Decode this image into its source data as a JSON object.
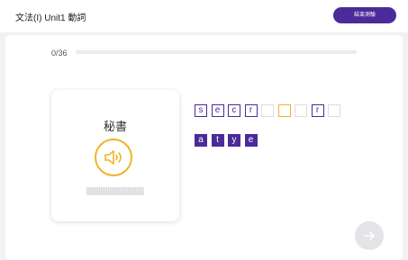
{
  "header": {
    "title": "文法(I) Unit1 動詞",
    "end_button_label": "結束測驗"
  },
  "progress": {
    "counter": "0/36",
    "fraction": 0
  },
  "question": {
    "word": "秘書",
    "audio_icon": "speaker-icon"
  },
  "answer_slots": [
    "s",
    "e",
    "c",
    "r",
    "",
    "",
    "",
    "r",
    ""
  ],
  "active_slot_index": 5,
  "letter_tiles": [
    "a",
    "t",
    "y",
    "e"
  ],
  "next_button": {
    "icon": "arrow-right-icon"
  },
  "colors": {
    "accent": "#4b2a9a",
    "speaker": "#f0b32a",
    "background": "#f2f2f4"
  }
}
